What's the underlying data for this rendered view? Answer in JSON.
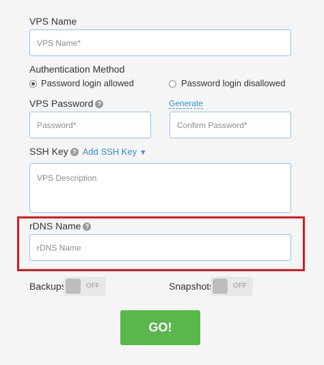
{
  "form": {
    "vps_name": {
      "label": "VPS Name",
      "placeholder": "VPS Name*"
    },
    "auth": {
      "label": "Authentication Method",
      "option_allowed": "Password login allowed",
      "option_disallowed": "Password login disallowed",
      "selected": "Password login allowed"
    },
    "password": {
      "label": "VPS Password",
      "generate_link": "Generate",
      "placeholder": "Password*",
      "confirm_placeholder": "Confirm Password*"
    },
    "ssh": {
      "label": "SSH Key",
      "add_link": "Add SSH Key",
      "dropdown_arrow": "▼",
      "description_placeholder": "VPS Description"
    },
    "rdns": {
      "label": "rDNS Name",
      "placeholder": "rDNS Name"
    },
    "backups": {
      "label": "Backups",
      "state": "OFF"
    },
    "snapshots": {
      "label": "Snapshots",
      "state": "OFF"
    },
    "submit_label": "GO!",
    "help_glyph": "?"
  },
  "colors": {
    "field_border": "#8fc3ea",
    "link": "#2f8fd6",
    "highlight": "#e3131b",
    "go_button": "#5ab74c"
  }
}
